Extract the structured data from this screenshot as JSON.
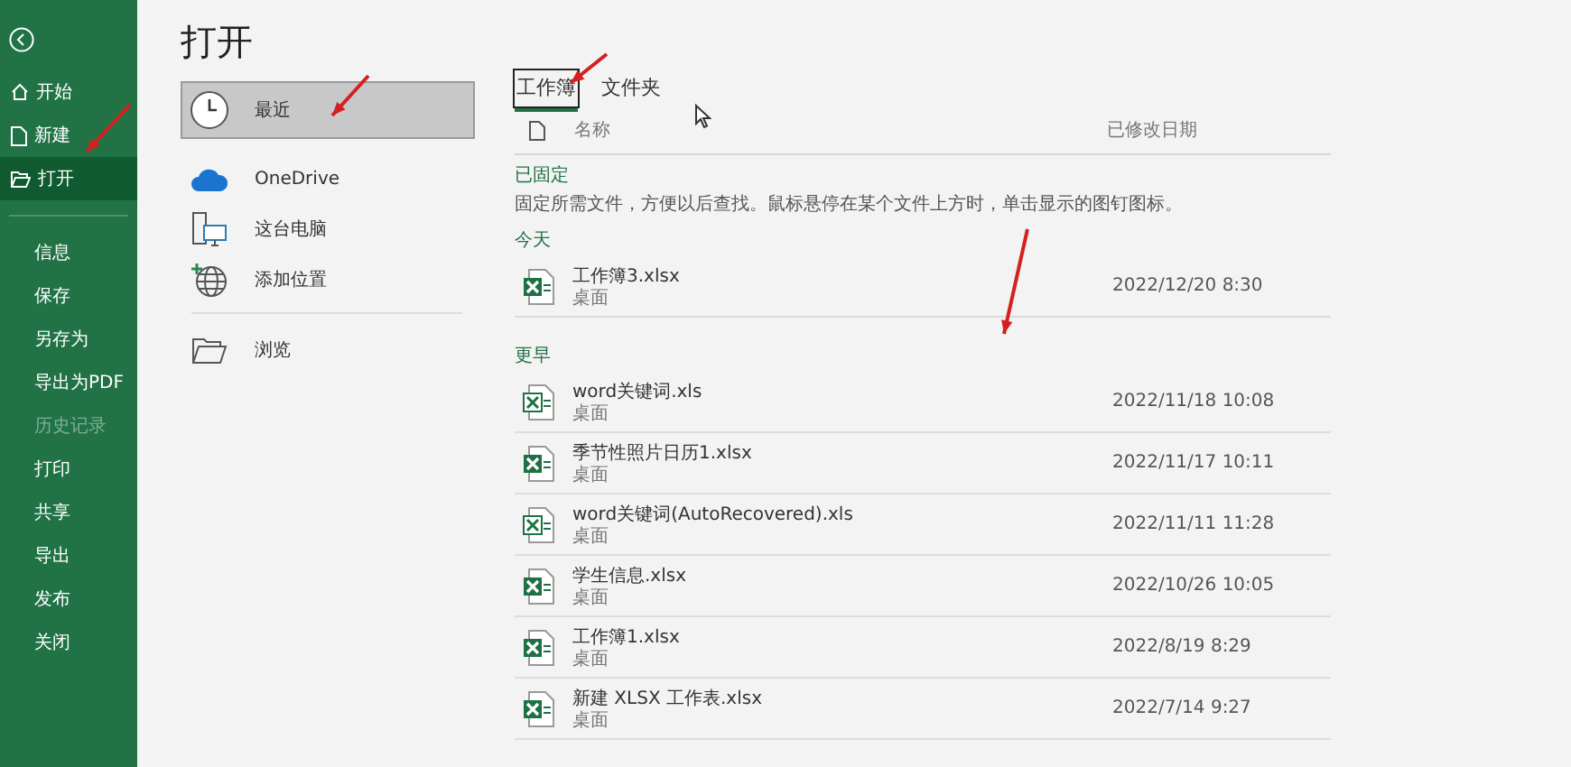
{
  "sidebar": {
    "items": [
      {
        "label": "开始",
        "kind": "home",
        "selected": false,
        "disabled": false
      },
      {
        "label": "新建",
        "kind": "new",
        "selected": false,
        "disabled": false
      },
      {
        "label": "打开",
        "kind": "open",
        "selected": true,
        "disabled": false
      },
      {
        "label": "信息",
        "kind": "plain",
        "selected": false,
        "disabled": false
      },
      {
        "label": "保存",
        "kind": "plain",
        "selected": false,
        "disabled": false
      },
      {
        "label": "另存为",
        "kind": "plain",
        "selected": false,
        "disabled": false
      },
      {
        "label": "导出为PDF",
        "kind": "plain",
        "selected": false,
        "disabled": false
      },
      {
        "label": "历史记录",
        "kind": "plain",
        "selected": false,
        "disabled": true
      },
      {
        "label": "打印",
        "kind": "plain",
        "selected": false,
        "disabled": false
      },
      {
        "label": "共享",
        "kind": "plain",
        "selected": false,
        "disabled": false
      },
      {
        "label": "导出",
        "kind": "plain",
        "selected": false,
        "disabled": false
      },
      {
        "label": "发布",
        "kind": "plain",
        "selected": false,
        "disabled": false
      },
      {
        "label": "关闭",
        "kind": "plain",
        "selected": false,
        "disabled": false
      }
    ]
  },
  "page_title": "打开",
  "locations": [
    {
      "label": "最近",
      "kind": "recent",
      "selected": true
    },
    {
      "label": "OneDrive",
      "kind": "cloud",
      "selected": false
    },
    {
      "label": "这台电脑",
      "kind": "computer",
      "selected": false
    },
    {
      "label": "添加位置",
      "kind": "add",
      "selected": false
    },
    {
      "label": "浏览",
      "kind": "browse",
      "selected": false
    }
  ],
  "tabs": [
    {
      "label": "工作簿",
      "selected": true
    },
    {
      "label": "文件夹",
      "selected": false
    }
  ],
  "columns": {
    "name": "名称",
    "modified": "已修改日期"
  },
  "pinned": {
    "heading": "已固定",
    "hint": "固定所需文件，方便以后查找。鼠标悬停在某个文件上方时，单击显示的图钉图标。"
  },
  "groups": [
    {
      "heading": "今天",
      "files": [
        {
          "name": "工作簿3.xlsx",
          "location": "桌面",
          "modified": "2022/12/20 8:30",
          "kind": "xlsx"
        }
      ]
    },
    {
      "heading": "更早",
      "files": [
        {
          "name": "word关键词.xls",
          "location": "桌面",
          "modified": "2022/11/18 10:08",
          "kind": "xls"
        },
        {
          "name": "季节性照片日历1.xlsx",
          "location": "桌面",
          "modified": "2022/11/17 10:11",
          "kind": "xlsx"
        },
        {
          "name": "word关键词(AutoRecovered).xls",
          "location": "桌面",
          "modified": "2022/11/11 11:28",
          "kind": "xls"
        },
        {
          "name": "学生信息.xlsx",
          "location": "桌面",
          "modified": "2022/10/26 10:05",
          "kind": "xlsx"
        },
        {
          "name": "工作簿1.xlsx",
          "location": "桌面",
          "modified": "2022/8/19 8:29",
          "kind": "xlsx"
        },
        {
          "name": "新建 XLSX 工作表.xlsx",
          "location": "桌面",
          "modified": "2022/7/14 9:27",
          "kind": "xlsx"
        }
      ]
    }
  ]
}
